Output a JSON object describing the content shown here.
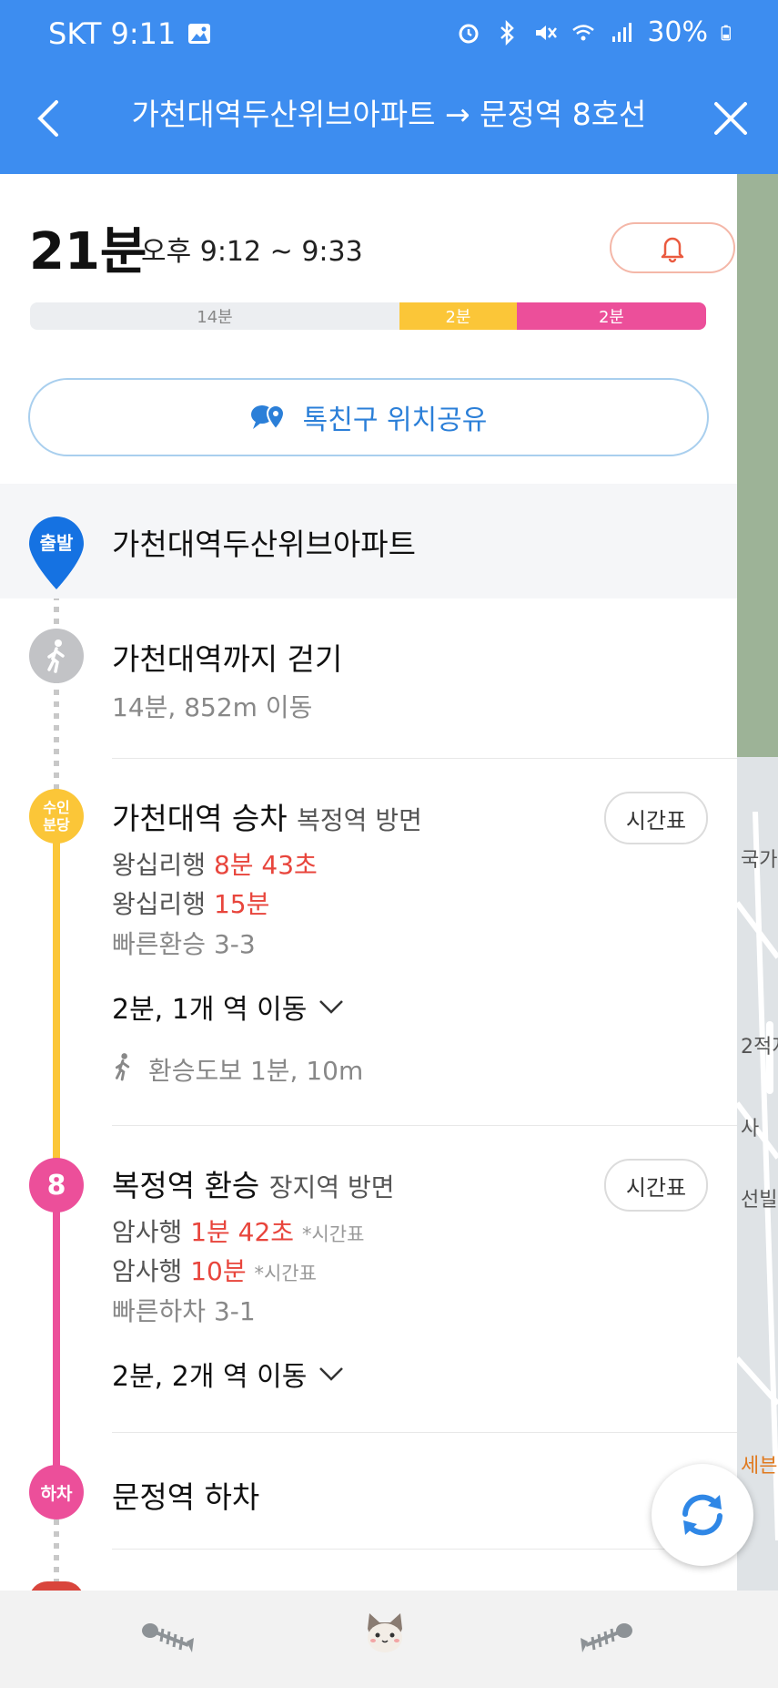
{
  "status_bar": {
    "carrier_time": "SKT 9:11",
    "battery": "30%"
  },
  "header": {
    "route_title": "가천대역두산위브아파트 → 문정역 8호선"
  },
  "summary": {
    "duration": "21분",
    "time_range": "오후 9:12 ~ 9:33",
    "segments": [
      {
        "label": "14분",
        "kind": "walk"
      },
      {
        "label": "2분",
        "kind": "line-suin"
      },
      {
        "label": "2분",
        "kind": "line-8"
      }
    ],
    "share_label": "톡친구 위치공유"
  },
  "steps": {
    "start": {
      "badge": "출발",
      "title": "가천대역두산위브아파트"
    },
    "walk": {
      "title": "가천대역까지 걷기",
      "detail": "14분, 852m 이동"
    },
    "board": {
      "badge_line1": "수인",
      "badge_line2": "분당",
      "title": "가천대역 승차",
      "direction": "복정역 방면",
      "timetable_label": "시간표",
      "arrivals": [
        {
          "dest": "왕십리행",
          "time": "8분 43초"
        },
        {
          "dest": "왕십리행",
          "time": "15분"
        }
      ],
      "fast_transfer": "빠른환승 3-3",
      "move_summary": "2분, 1개 역 이동",
      "transfer_walk": "환승도보 1분, 10m"
    },
    "transfer": {
      "badge": "8",
      "title": "복정역 환승",
      "direction": "장지역 방면",
      "timetable_label": "시간표",
      "arrivals": [
        {
          "dest": "암사행",
          "time": "1분 42초",
          "note": "*시간표"
        },
        {
          "dest": "암사행",
          "time": "10분",
          "note": "*시간표"
        }
      ],
      "fast_exit": "빠른하차 3-1",
      "move_summary": "2분, 2개 역 이동"
    },
    "alight": {
      "badge": "하차",
      "title": "문정역 하차"
    }
  },
  "map_labels": [
    "국가",
    "2적지",
    "사",
    "선빌",
    "세븐"
  ],
  "colors": {
    "header": "#3d8df0",
    "line_suin": "#fbc638",
    "line_8": "#ec4f9a",
    "accent_blue": "#1f6fd1",
    "red": "#e8453c"
  }
}
